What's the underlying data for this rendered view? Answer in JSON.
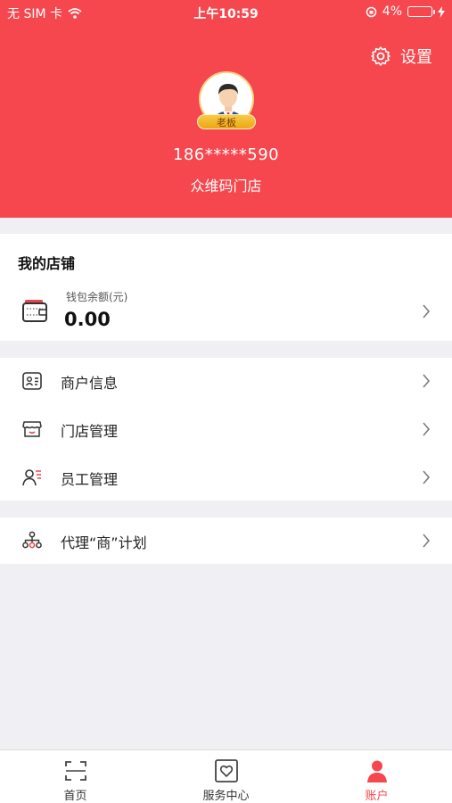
{
  "status_bar": {
    "carrier": "无 SIM 卡",
    "time": "上午10:59",
    "battery": "4%"
  },
  "header": {
    "settings_label": "设置",
    "role_badge": "老板",
    "phone": "186*****590",
    "store_name": "众维码门店"
  },
  "shop_section": {
    "title": "我的店铺",
    "wallet_label": "钱包余额(元)",
    "wallet_value": "0.00"
  },
  "menu": [
    {
      "label": "商户信息",
      "icon": "merchant-card-icon"
    },
    {
      "label": "门店管理",
      "icon": "storefront-icon"
    },
    {
      "label": "员工管理",
      "icon": "staff-icon"
    }
  ],
  "agent": {
    "label": "代理“商”计划",
    "icon": "org-tree-icon"
  },
  "tabbar": [
    {
      "label": "首页",
      "icon": "scan-icon",
      "active": false
    },
    {
      "label": "服务中心",
      "icon": "heart-box-icon",
      "active": false
    },
    {
      "label": "账户",
      "icon": "person-icon",
      "active": true
    }
  ],
  "colors": {
    "brand_red": "#f5474d",
    "badge_gold": "#f9c948",
    "background": "#efeff4"
  }
}
